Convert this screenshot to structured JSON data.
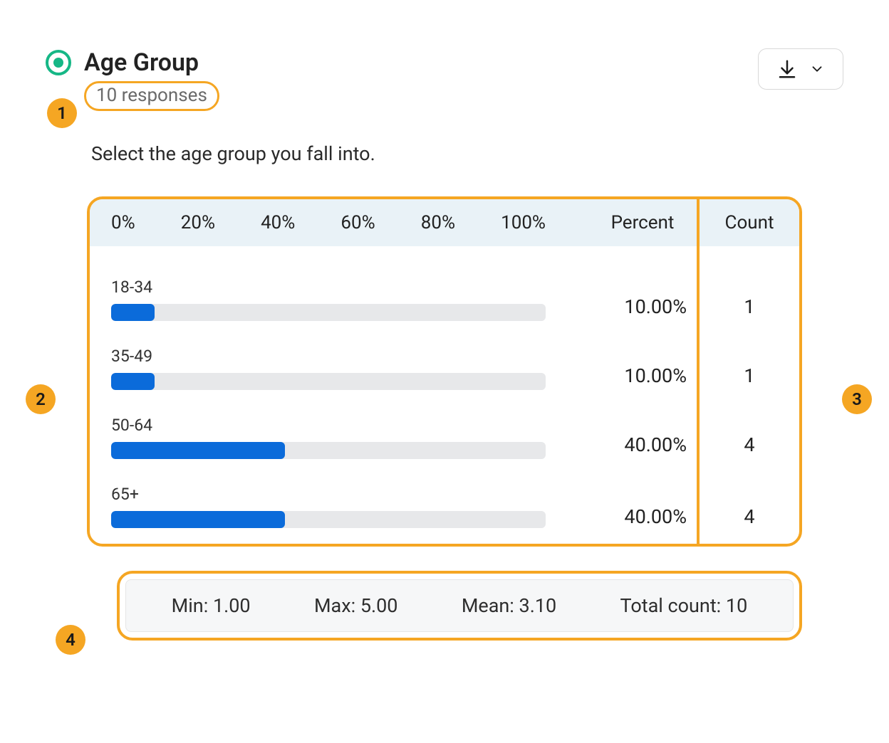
{
  "question": {
    "title": "Age Group",
    "responses_text": "10 responses",
    "description": "Select the age group you fall into."
  },
  "headers": {
    "percent": "Percent",
    "count": "Count"
  },
  "axis_ticks": [
    "0%",
    "20%",
    "40%",
    "60%",
    "80%",
    "100%"
  ],
  "rows": [
    {
      "label": "18-34",
      "percent_text": "10.00%",
      "count_text": "1",
      "percent_value": 10
    },
    {
      "label": "35-49",
      "percent_text": "10.00%",
      "count_text": "1",
      "percent_value": 10
    },
    {
      "label": "50-64",
      "percent_text": "40.00%",
      "count_text": "4",
      "percent_value": 40
    },
    {
      "label": "65+",
      "percent_text": "40.00%",
      "count_text": "4",
      "percent_value": 40
    }
  ],
  "stats": {
    "min": {
      "label": "Min: ",
      "value": "1.00"
    },
    "max": {
      "label": "Max: ",
      "value": "5.00"
    },
    "mean": {
      "label": "Mean: ",
      "value": "3.10"
    },
    "total": {
      "label": "Total count: ",
      "value": "10"
    }
  },
  "annotations": {
    "one": "1",
    "two": "2",
    "three": "3",
    "four": "4"
  },
  "colors": {
    "accent_orange": "#f5a623",
    "bar_blue": "#0b6bda",
    "header_bg": "#e9f2f7",
    "track_gray": "#e7e8ea",
    "radio_green": "#16b786"
  },
  "chart_data": {
    "type": "bar",
    "orientation": "horizontal",
    "title": "Age Group",
    "xlabel": "",
    "ylabel": "",
    "xlim": [
      0,
      100
    ],
    "x_ticks": [
      0,
      20,
      40,
      60,
      80,
      100
    ],
    "categories": [
      "18-34",
      "35-49",
      "50-64",
      "65+"
    ],
    "values": [
      10,
      10,
      40,
      40
    ],
    "counts": [
      1,
      1,
      4,
      4
    ],
    "summary": {
      "min": 1.0,
      "max": 5.0,
      "mean": 3.1,
      "total_count": 10
    }
  }
}
